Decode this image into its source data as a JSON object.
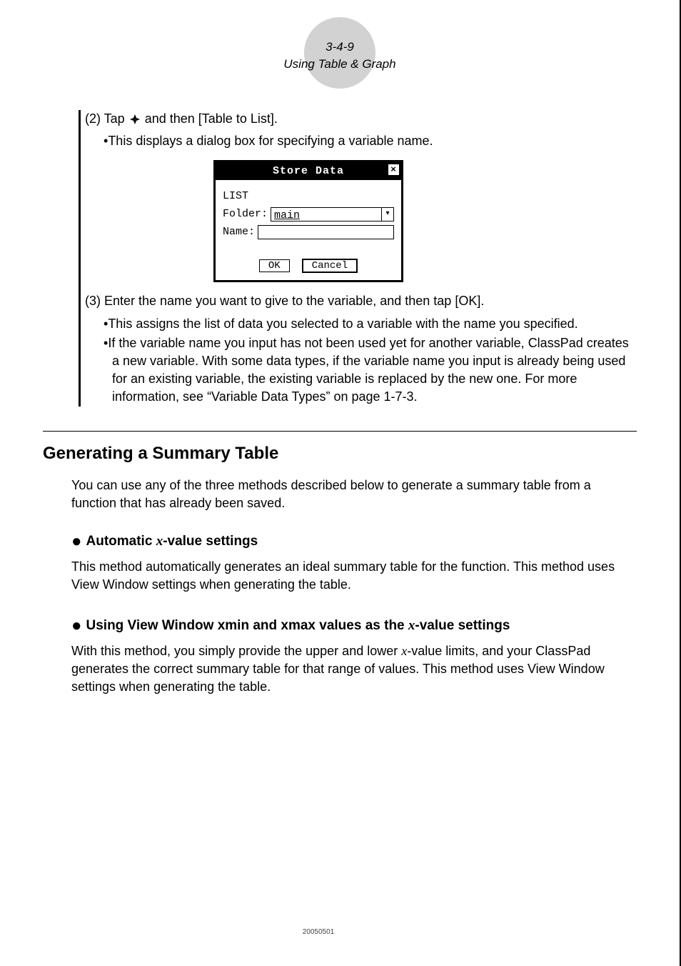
{
  "header": {
    "page_number": "3-4-9",
    "section_title": "Using Table & Graph"
  },
  "instructions": {
    "step2_prefix": "(2) Tap ",
    "step2_suffix": " and then [Table to List].",
    "step2_bullet": "This displays a dialog box for specifying a variable name.",
    "step3": "(3) Enter the name you want to give to the variable, and then tap [OK].",
    "step3_bullet1": "This assigns the list of data you selected to a variable with the name you specified.",
    "step3_bullet2": "If the variable name you input has not been used yet for another variable, ClassPad creates a new variable. With some data types, if the variable name you input is already being used for an existing variable, the existing variable is replaced by the new one. For more information, see “Variable Data Types” on page 1-7-3."
  },
  "dialog": {
    "title": "Store Data",
    "close_symbol": "×",
    "type_label": "LIST",
    "folder_label": "Folder:",
    "folder_value": "main",
    "folder_arrow": "▾",
    "name_label": "Name:",
    "name_value": "",
    "ok_label": "OK",
    "cancel_label": "Cancel"
  },
  "section": {
    "heading": "Generating a Summary Table",
    "intro": "You can use any of the three methods described below to generate a summary table from a function that has already been saved.",
    "sub1_prefix": "Automatic ",
    "sub1_var": "x",
    "sub1_suffix": "-value settings",
    "sub1_text": "This method automatically generates an ideal summary table for the function.  This method uses View Window settings when generating the table.",
    "sub2_prefix": "Using View Window xmin and xmax values as the ",
    "sub2_var": "x",
    "sub2_suffix": "-value settings",
    "sub2_text_a": "With this method, you simply provide the upper and lower ",
    "sub2_text_var": "x",
    "sub2_text_b": "-value limits, and your ClassPad generates the correct summary table for that range of values. This method uses View Window settings when generating the table."
  },
  "footer": {
    "code": "20050501"
  }
}
